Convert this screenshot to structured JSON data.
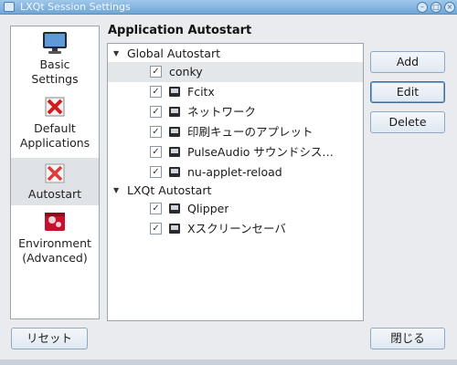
{
  "window": {
    "title": "LXQt Session Settings",
    "controls": [
      "minimize",
      "maximize",
      "close"
    ]
  },
  "sidebar": {
    "items": [
      {
        "label": "Basic\nSettings",
        "icon": "monitor-icon",
        "selected": false
      },
      {
        "label": "Default\nApplications",
        "icon": "default-apps-icon",
        "selected": false
      },
      {
        "label": "Autostart",
        "icon": "autostart-icon",
        "selected": true
      },
      {
        "label": "Environment\n(Advanced)",
        "icon": "environment-icon",
        "selected": false
      }
    ]
  },
  "main": {
    "title": "Application Autostart",
    "groups": [
      {
        "label": "Global Autostart",
        "expanded": true,
        "items": [
          {
            "label": "conky",
            "checked": true,
            "has_icon": false,
            "highlighted": true
          },
          {
            "label": "Fcitx",
            "checked": true,
            "has_icon": true,
            "highlighted": false
          },
          {
            "label": "ネットワーク",
            "checked": true,
            "has_icon": true,
            "highlighted": false
          },
          {
            "label": "印刷キューのアプレット",
            "checked": true,
            "has_icon": true,
            "highlighted": false
          },
          {
            "label": "PulseAudio サウンドシス…",
            "checked": true,
            "has_icon": true,
            "highlighted": false
          },
          {
            "label": "nu-applet-reload",
            "checked": true,
            "has_icon": true,
            "highlighted": false
          }
        ]
      },
      {
        "label": "LXQt Autostart",
        "expanded": true,
        "items": [
          {
            "label": "Qlipper",
            "checked": true,
            "has_icon": true,
            "highlighted": false
          },
          {
            "label": "Xスクリーンセーバ",
            "checked": true,
            "has_icon": true,
            "highlighted": false
          }
        ]
      }
    ]
  },
  "buttons": {
    "add": "Add",
    "edit": "Edit",
    "delete": "Delete",
    "reset": "リセット",
    "close": "閉じる"
  },
  "colors": {
    "titlebar": "#7fb2df",
    "selection": "#dfe3e8",
    "window_bg": "#e9ebee"
  }
}
